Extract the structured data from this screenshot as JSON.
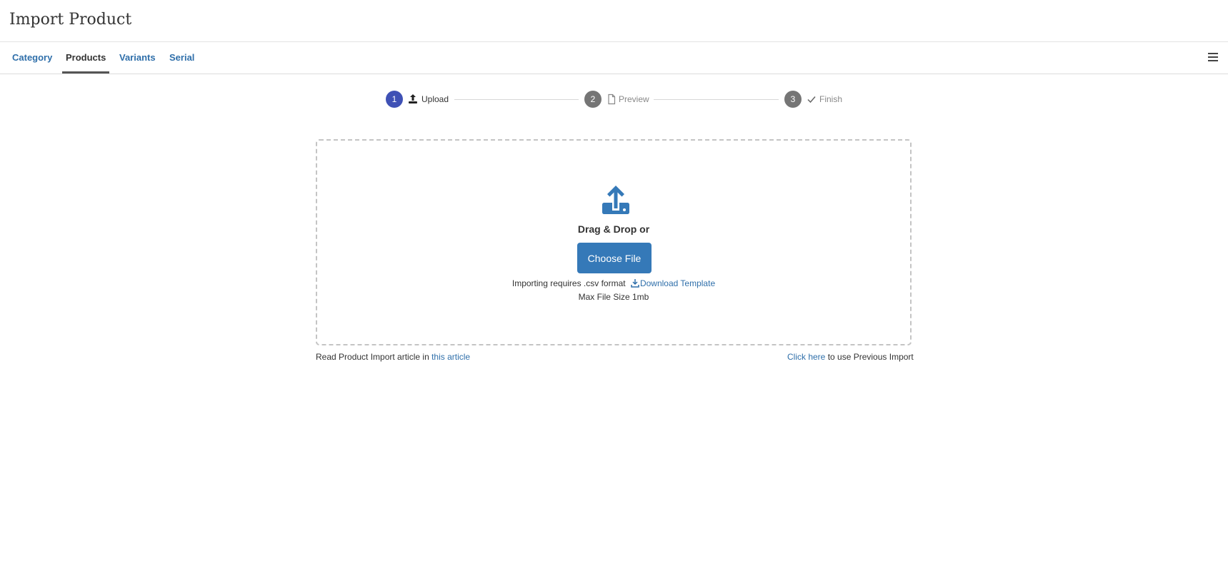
{
  "header": {
    "title": "Import Product"
  },
  "tabs": [
    {
      "label": "Category",
      "active": false
    },
    {
      "label": "Products",
      "active": true
    },
    {
      "label": "Variants",
      "active": false
    },
    {
      "label": "Serial",
      "active": false
    }
  ],
  "menu": {
    "icon": "hamburger-icon"
  },
  "stepper": {
    "steps": [
      {
        "number": "1",
        "label": "Upload",
        "icon": "upload-icon",
        "state": "active"
      },
      {
        "number": "2",
        "label": "Preview",
        "icon": "document-icon",
        "state": "pending"
      },
      {
        "number": "3",
        "label": "Finish",
        "icon": "check-icon",
        "state": "pending"
      }
    ]
  },
  "dropzone": {
    "icon": "upload-icon",
    "drag_text": "Drag & Drop or",
    "choose_button": "Choose File",
    "requirement": "Importing requires .csv format",
    "download_link": "Download Template",
    "download_icon": "download-icon",
    "max_size": "Max File Size 1mb"
  },
  "footer": {
    "left_prefix": "Read Product Import article in ",
    "left_link": "this article",
    "right_link": "Click here",
    "right_suffix": " to use Previous Import"
  },
  "colors": {
    "accent": "#3f51b5",
    "primary_button": "#3579b8",
    "link": "#2f6faa",
    "step_inactive": "#757575"
  }
}
